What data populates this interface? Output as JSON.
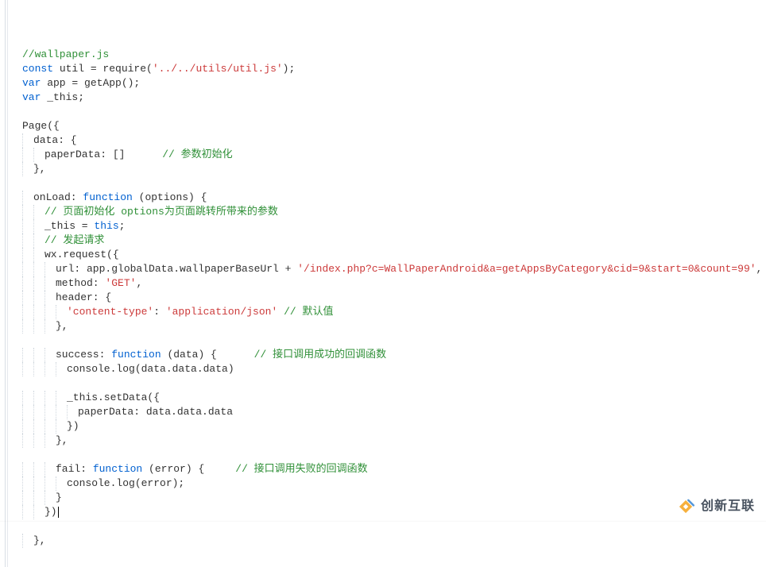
{
  "watermark": {
    "text": "创新互联"
  },
  "code": {
    "lines": [
      {
        "indent": 0,
        "segments": [
          {
            "c": "cmt",
            "t": "//wallpaper.js"
          }
        ]
      },
      {
        "indent": 0,
        "segments": [
          {
            "c": "kw",
            "t": "const"
          },
          {
            "c": "ident",
            "t": " util = require("
          },
          {
            "c": "str",
            "t": "'../../utils/util.js'"
          },
          {
            "c": "ident",
            "t": ");"
          }
        ]
      },
      {
        "indent": 0,
        "segments": [
          {
            "c": "kw",
            "t": "var"
          },
          {
            "c": "ident",
            "t": " app = getApp();"
          }
        ]
      },
      {
        "indent": 0,
        "segments": [
          {
            "c": "kw",
            "t": "var"
          },
          {
            "c": "ident",
            "t": " _this;"
          }
        ]
      },
      {
        "indent": 0,
        "segments": [
          {
            "c": "ident",
            "t": ""
          }
        ]
      },
      {
        "indent": 0,
        "segments": [
          {
            "c": "ident",
            "t": "Page({"
          }
        ]
      },
      {
        "indent": 1,
        "segments": [
          {
            "c": "ident",
            "t": "data: {"
          }
        ]
      },
      {
        "indent": 2,
        "segments": [
          {
            "c": "ident",
            "t": "paperData: []      "
          },
          {
            "c": "cmt",
            "t": "// 参数初始化"
          }
        ]
      },
      {
        "indent": 1,
        "segments": [
          {
            "c": "ident",
            "t": "},"
          }
        ]
      },
      {
        "indent": 0,
        "segments": [
          {
            "c": "ident",
            "t": ""
          }
        ]
      },
      {
        "indent": 1,
        "segments": [
          {
            "c": "ident",
            "t": "onLoad: "
          },
          {
            "c": "kw",
            "t": "function"
          },
          {
            "c": "ident",
            "t": " (options) {"
          }
        ]
      },
      {
        "indent": 2,
        "segments": [
          {
            "c": "cmt",
            "t": "// 页面初始化 options为页面跳转所带来的参数"
          }
        ]
      },
      {
        "indent": 2,
        "segments": [
          {
            "c": "ident",
            "t": "_this = "
          },
          {
            "c": "kw",
            "t": "this"
          },
          {
            "c": "ident",
            "t": ";"
          }
        ]
      },
      {
        "indent": 2,
        "segments": [
          {
            "c": "cmt",
            "t": "// 发起请求"
          }
        ]
      },
      {
        "indent": 2,
        "segments": [
          {
            "c": "ident",
            "t": "wx.request({"
          }
        ]
      },
      {
        "indent": 3,
        "segments": [
          {
            "c": "ident",
            "t": "url: app.globalData.wallpaperBaseUrl + "
          },
          {
            "c": "str",
            "t": "'/index.php?c=WallPaperAndroid&a=getAppsByCategory&cid=9&start=0&count=99'"
          },
          {
            "c": "ident",
            "t": ","
          }
        ]
      },
      {
        "indent": 3,
        "segments": [
          {
            "c": "ident",
            "t": "method: "
          },
          {
            "c": "str",
            "t": "'GET'"
          },
          {
            "c": "ident",
            "t": ","
          }
        ]
      },
      {
        "indent": 3,
        "segments": [
          {
            "c": "ident",
            "t": "header: {"
          }
        ]
      },
      {
        "indent": 4,
        "segments": [
          {
            "c": "str",
            "t": "'content-type'"
          },
          {
            "c": "ident",
            "t": ": "
          },
          {
            "c": "str",
            "t": "'application/json'"
          },
          {
            "c": "ident",
            "t": " "
          },
          {
            "c": "cmt",
            "t": "// 默认值"
          }
        ]
      },
      {
        "indent": 3,
        "segments": [
          {
            "c": "ident",
            "t": "},"
          }
        ]
      },
      {
        "indent": 0,
        "segments": [
          {
            "c": "ident",
            "t": ""
          }
        ]
      },
      {
        "indent": 3,
        "segments": [
          {
            "c": "ident",
            "t": "success: "
          },
          {
            "c": "kw",
            "t": "function"
          },
          {
            "c": "ident",
            "t": " (data) {      "
          },
          {
            "c": "cmt",
            "t": "// 接口调用成功的回调函数"
          }
        ]
      },
      {
        "indent": 4,
        "segments": [
          {
            "c": "ident",
            "t": "console.log(data.data.data)"
          }
        ]
      },
      {
        "indent": 0,
        "segments": [
          {
            "c": "ident",
            "t": ""
          }
        ]
      },
      {
        "indent": 4,
        "segments": [
          {
            "c": "ident",
            "t": "_this.setData({"
          }
        ]
      },
      {
        "indent": 5,
        "segments": [
          {
            "c": "ident",
            "t": "paperData: data.data.data"
          }
        ]
      },
      {
        "indent": 4,
        "segments": [
          {
            "c": "ident",
            "t": "})"
          }
        ]
      },
      {
        "indent": 3,
        "segments": [
          {
            "c": "ident",
            "t": "},"
          }
        ]
      },
      {
        "indent": 0,
        "segments": [
          {
            "c": "ident",
            "t": ""
          }
        ]
      },
      {
        "indent": 3,
        "segments": [
          {
            "c": "ident",
            "t": "fail: "
          },
          {
            "c": "kw",
            "t": "function"
          },
          {
            "c": "ident",
            "t": " (error) {     "
          },
          {
            "c": "cmt",
            "t": "// 接口调用失败的回调函数"
          }
        ]
      },
      {
        "indent": 4,
        "segments": [
          {
            "c": "ident",
            "t": "console.log(error);"
          }
        ]
      },
      {
        "indent": 3,
        "segments": [
          {
            "c": "ident",
            "t": "}"
          }
        ]
      },
      {
        "indent": 2,
        "caret": true,
        "segments": [
          {
            "c": "ident",
            "t": "})"
          }
        ]
      },
      {
        "indent": 0,
        "segments": [
          {
            "c": "ident",
            "t": ""
          }
        ]
      },
      {
        "indent": 1,
        "segments": [
          {
            "c": "ident",
            "t": "},"
          }
        ]
      }
    ]
  }
}
